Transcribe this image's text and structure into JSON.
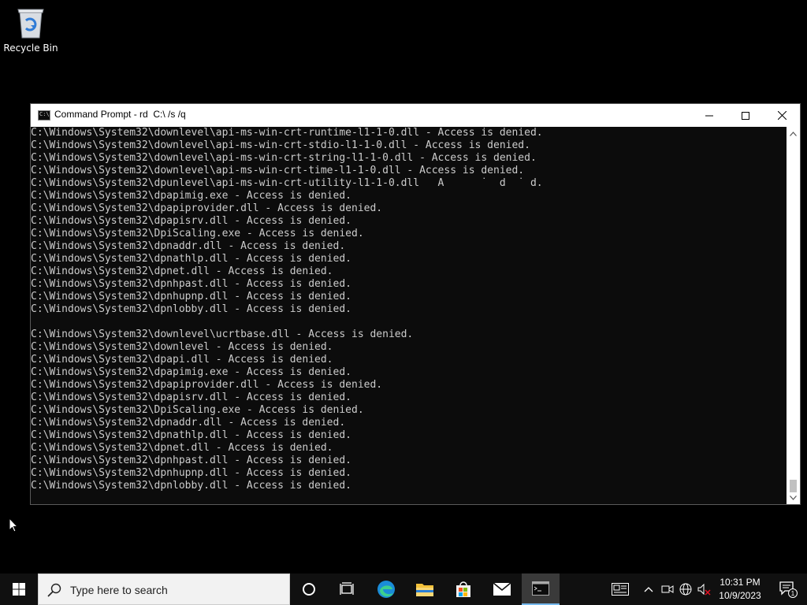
{
  "desktop": {
    "recycle_bin_label": "Recycle Bin"
  },
  "window": {
    "title": "Command Prompt - rd  C:\\ /s /q",
    "lines": [
      "C:\\Windows\\System32\\downlevel\\api-ms-win-crt-runtime-l1-1-0.dll - Access is denied.",
      "C:\\Windows\\System32\\downlevel\\api-ms-win-crt-stdio-l1-1-0.dll - Access is denied.",
      "C:\\Windows\\System32\\downlevel\\api-ms-win-crt-string-l1-1-0.dll - Access is denied.",
      "C:\\Windows\\System32\\downlevel\\api-ms-win-crt-time-l1-1-0.dll - Access is denied.",
      "C:\\Windows\\System32\\dpunlevel\\api-ms-win-crt-utility-l1-1-0.dll   A      ˙  d  ˙ d.",
      "C:\\Windows\\System32\\dpapimig.exe - Access is denied.",
      "C:\\Windows\\System32\\dpapiprovider.dll - Access is denied.",
      "C:\\Windows\\System32\\dpapisrv.dll - Access is denied.",
      "C:\\Windows\\System32\\DpiScaling.exe - Access is denied.",
      "C:\\Windows\\System32\\dpnaddr.dll - Access is denied.",
      "C:\\Windows\\System32\\dpnathlp.dll - Access is denied.",
      "C:\\Windows\\System32\\dpnet.dll - Access is denied.",
      "C:\\Windows\\System32\\dpnhpast.dll - Access is denied.",
      "C:\\Windows\\System32\\dpnhupnp.dll - Access is denied.",
      "C:\\Windows\\System32\\dpnlobby.dll - Access is denied.",
      "",
      "C:\\Windows\\System32\\downlevel\\ucrtbase.dll - Access is denied.",
      "C:\\Windows\\System32\\downlevel - Access is denied.",
      "C:\\Windows\\System32\\dpapi.dll - Access is denied.",
      "C:\\Windows\\System32\\dpapimig.exe - Access is denied.",
      "C:\\Windows\\System32\\dpapiprovider.dll - Access is denied.",
      "C:\\Windows\\System32\\dpapisrv.dll - Access is denied.",
      "C:\\Windows\\System32\\DpiScaling.exe - Access is denied.",
      "C:\\Windows\\System32\\dpnaddr.dll - Access is denied.",
      "C:\\Windows\\System32\\dpnathlp.dll - Access is denied.",
      "C:\\Windows\\System32\\dpnet.dll - Access is denied.",
      "C:\\Windows\\System32\\dpnhpast.dll - Access is denied.",
      "C:\\Windows\\System32\\dpnhupnp.dll - Access is denied.",
      "C:\\Windows\\System32\\dpnlobby.dll - Access is denied."
    ],
    "controls": {
      "minimize_icon": "minimize-icon",
      "maximize_icon": "maximize-icon",
      "close_icon": "close-icon"
    }
  },
  "taskbar": {
    "search_placeholder": "Type here to search",
    "apps": [
      "start-icon",
      "cortana-icon",
      "task-view-icon",
      "edge-icon",
      "file-explorer-icon",
      "store-icon",
      "mail-icon",
      "command-prompt-icon"
    ],
    "active_app": "command-prompt-icon",
    "clock_time": "10:31 PM",
    "clock_date": "10/9/2023",
    "notification_count": "1"
  },
  "colors": {
    "console_text": "#cccccc",
    "console_bg": "#0c0c0c",
    "taskbar_bg": "#101010",
    "active_indicator": "#76b9ed"
  }
}
